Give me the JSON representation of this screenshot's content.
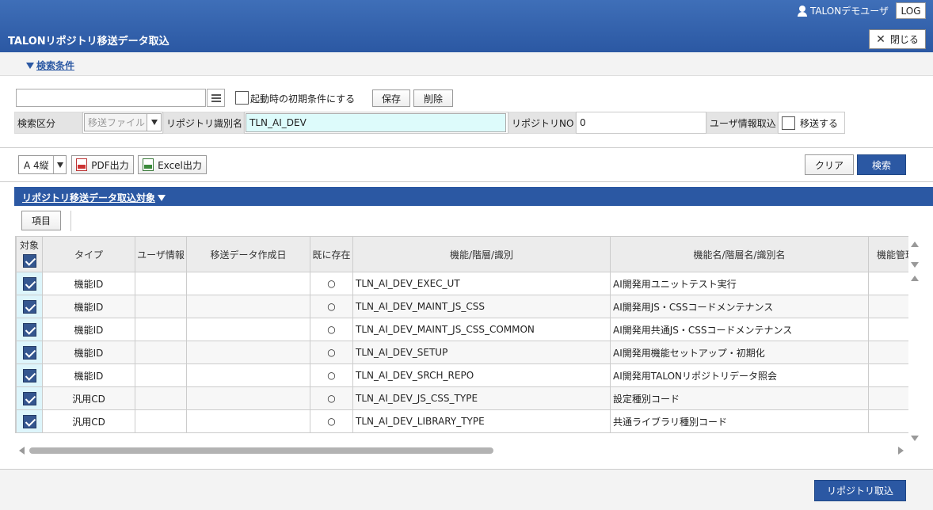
{
  "header": {
    "user_name": "TALONデモユーザ",
    "log_label": "LOG",
    "title": "TALONリポジトリ移送データ取込",
    "close_label": "閉じる"
  },
  "conditions": {
    "toggle_label": "検索条件",
    "search_value": "",
    "init_condition_label": "起動時の初期条件にする",
    "save_label": "保存",
    "delete_label": "削除",
    "search_kbn_label": "検索区分",
    "search_kbn_value": "移送ファイル",
    "repo_id_label": "リポジトリ識別名",
    "repo_id_value": "TLN_AI_DEV",
    "repo_no_label": "リポジトリNO",
    "repo_no_value": "0",
    "user_info_label": "ユーザ情報取込",
    "transfer_label": "移送する"
  },
  "actions": {
    "paper_value": "A 4縦",
    "pdf_label": "PDF出力",
    "excel_label": "Excel出力",
    "clear_label": "クリア",
    "search_label": "検索"
  },
  "section": {
    "title": "リポジトリ移送データ取込対象",
    "items_label": "項目"
  },
  "table": {
    "headers": [
      "対象",
      "タイプ",
      "ユーザ情報",
      "移送データ作成日",
      "既に存在",
      "機能/階層/識別",
      "機能名/階層名/識別名",
      "機能管理"
    ],
    "rows": [
      {
        "type": "機能ID",
        "user_info": "",
        "created": "",
        "exists": "○",
        "id": "TLN_AI_DEV_EXEC_UT",
        "name": "AI開発用ユニットテスト実行"
      },
      {
        "type": "機能ID",
        "user_info": "",
        "created": "",
        "exists": "○",
        "id": "TLN_AI_DEV_MAINT_JS_CSS",
        "name": "AI開発用JS・CSSコードメンテナンス"
      },
      {
        "type": "機能ID",
        "user_info": "",
        "created": "",
        "exists": "○",
        "id": "TLN_AI_DEV_MAINT_JS_CSS_COMMON",
        "name": "AI開発用共通JS・CSSコードメンテナンス"
      },
      {
        "type": "機能ID",
        "user_info": "",
        "created": "",
        "exists": "○",
        "id": "TLN_AI_DEV_SETUP",
        "name": "AI開発用機能セットアップ・初期化"
      },
      {
        "type": "機能ID",
        "user_info": "",
        "created": "",
        "exists": "○",
        "id": "TLN_AI_DEV_SRCH_REPO",
        "name": "AI開発用TALONリポジトリデータ照会"
      },
      {
        "type": "汎用CD",
        "user_info": "",
        "created": "",
        "exists": "○",
        "id": "TLN_AI_DEV_JS_CSS_TYPE",
        "name": "設定種別コード"
      },
      {
        "type": "汎用CD",
        "user_info": "",
        "created": "",
        "exists": "○",
        "id": "TLN_AI_DEV_LIBRARY_TYPE",
        "name": "共通ライブラリ種別コード"
      }
    ]
  },
  "footer": {
    "import_label": "リポジトリ取込"
  }
}
